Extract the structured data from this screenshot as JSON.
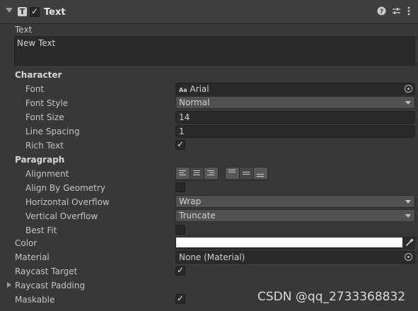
{
  "header": {
    "title": "Text",
    "component_icon": "T",
    "enabled": true,
    "icons": [
      "help-icon",
      "presets-icon",
      "more-options-icon"
    ]
  },
  "text_label": "Text",
  "text_value": "New Text",
  "character": {
    "section": "Character",
    "font_label": "Font",
    "font_icon": "Aa",
    "font_value": "Arial",
    "font_style_label": "Font Style",
    "font_style_value": "Normal",
    "font_size_label": "Font Size",
    "font_size_value": "14",
    "line_spacing_label": "Line Spacing",
    "line_spacing_value": "1",
    "rich_text_label": "Rich Text",
    "rich_text": true
  },
  "paragraph": {
    "section": "Paragraph",
    "alignment_label": "Alignment",
    "horizontal_alignment": "center",
    "vertical_alignment": "middle",
    "align_by_geometry_label": "Align By Geometry",
    "align_by_geometry": false,
    "horizontal_overflow_label": "Horizontal Overflow",
    "horizontal_overflow_value": "Wrap",
    "vertical_overflow_label": "Vertical Overflow",
    "vertical_overflow_value": "Truncate",
    "best_fit_label": "Best Fit",
    "best_fit": false
  },
  "color_label": "Color",
  "color_value": "#ffffff",
  "material_label": "Material",
  "material_value": "None (Material)",
  "raycast_target_label": "Raycast Target",
  "raycast_target": true,
  "raycast_padding_label": "Raycast Padding",
  "maskable_label": "Maskable",
  "maskable": true,
  "watermark": "CSDN @qq_2733368832"
}
